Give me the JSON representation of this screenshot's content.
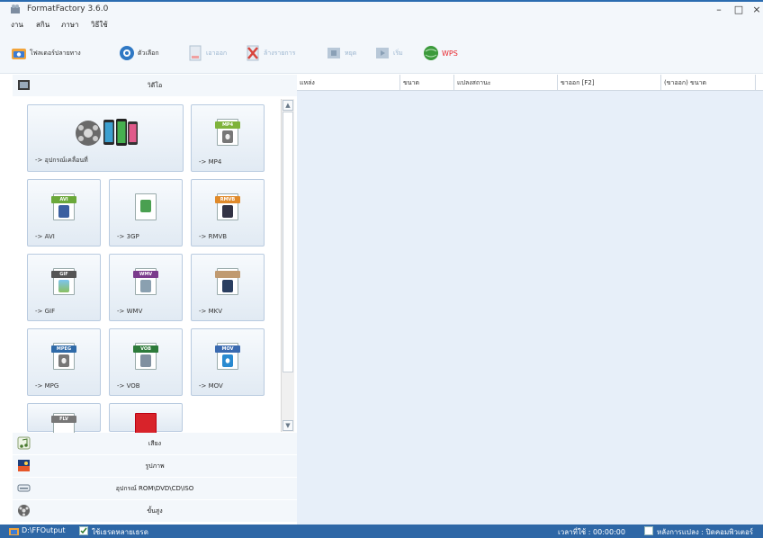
{
  "window": {
    "title": "FormatFactory 3.6.0",
    "minimize": "–",
    "maximize": "□",
    "close": "×"
  },
  "menu": [
    "งาน",
    "สกิน",
    "ภาษา",
    "วิธีใช้"
  ],
  "toolbar": {
    "output_folder": "โฟลเดอร์ปลายทาง",
    "options": "ตัวเลือก",
    "remove": "เอาออก",
    "clear_list": "ล้างรายการ",
    "stop": "หยุด",
    "start": "เริ่ม",
    "wps": "WPS"
  },
  "categories": {
    "video": "วิดีโอ",
    "audio": "เสียง",
    "picture": "รูปภาพ",
    "rom": "อุปกรณ์ ROM\\DVD\\CD\\ISO",
    "advanced": "ขั้นสูง"
  },
  "tiles": [
    {
      "label": "-> อุปกรณ์เคลื่อนที่",
      "fmt": ""
    },
    {
      "label": "-> MP4",
      "fmt": "MP4"
    },
    {
      "label": "-> AVI",
      "fmt": "AVI"
    },
    {
      "label": "-> 3GP",
      "fmt": "3GP"
    },
    {
      "label": "-> RMVB",
      "fmt": "RMVB"
    },
    {
      "label": "-> GIF",
      "fmt": "GIF"
    },
    {
      "label": "-> WMV",
      "fmt": "WMV"
    },
    {
      "label": "-> MKV",
      "fmt": "MKV"
    },
    {
      "label": "-> MPG",
      "fmt": "MPEG"
    },
    {
      "label": "-> VOB",
      "fmt": "VOB"
    },
    {
      "label": "-> MOV",
      "fmt": "MOV"
    },
    {
      "label": "",
      "fmt": "FLV"
    },
    {
      "label": "",
      "fmt": ""
    }
  ],
  "table": {
    "headers": [
      "แหล่ง",
      "ขนาด",
      "แปลงสถานะ",
      "ขาออก [F2]",
      "(ขาออก) ขนาด"
    ]
  },
  "status": {
    "output_path": "D:\\FFOutput",
    "multithread": "ใช้เธรดหลายเธรด",
    "elapsed": "เวลาที่ใช้ : 00:00:00",
    "after_convert": "หลังการแปลง : ปิดคอมพิวเตอร์"
  },
  "colors": {
    "accent": "#2e67a6",
    "list_bg": "#e7eff9",
    "wps": "#e8262c"
  }
}
